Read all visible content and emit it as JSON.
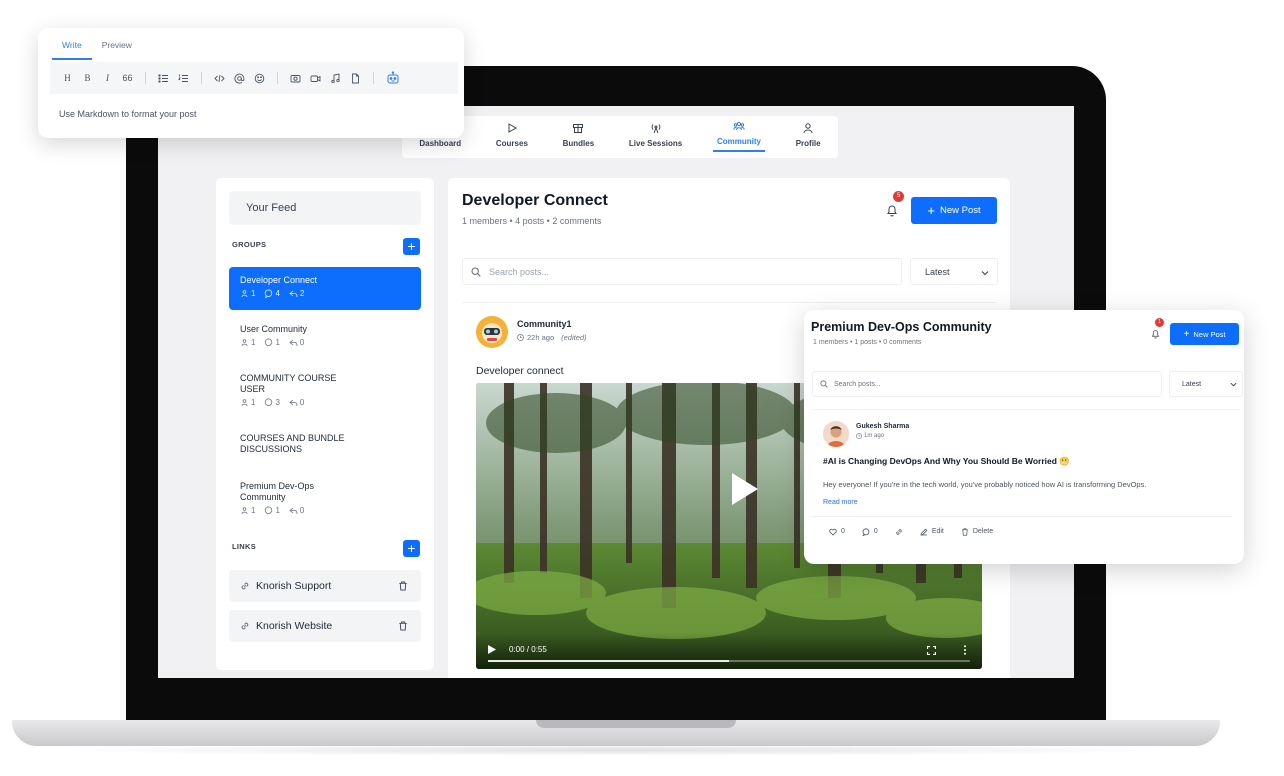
{
  "nav": {
    "items": [
      {
        "label": "Dashboard",
        "icon": "gauge-icon"
      },
      {
        "label": "Courses",
        "icon": "play-icon"
      },
      {
        "label": "Bundles",
        "icon": "box-icon"
      },
      {
        "label": "Live Sessions",
        "icon": "broadcast-icon"
      },
      {
        "label": "Community",
        "icon": "users-icon"
      },
      {
        "label": "Profile",
        "icon": "user-icon"
      }
    ],
    "active": "Community"
  },
  "sidebar": {
    "feed_label": "Your Feed",
    "groups_heading": "GROUPS",
    "add_symbol": "+",
    "groups": [
      {
        "name": "Developer Connect",
        "members": "1",
        "posts": "4",
        "comments": "2"
      },
      {
        "name": "User Community",
        "members": "1",
        "posts": "1",
        "comments": "0"
      },
      {
        "name": "COMMUNITY COURSE\nUSER",
        "members": "1",
        "posts": "3",
        "comments": "0"
      },
      {
        "name": "COURSES AND BUNDLE\nDISCUSSIONS"
      },
      {
        "name": "Premium Dev-Ops\nCommunity",
        "members": "1",
        "posts": "1",
        "comments": "0"
      }
    ],
    "links_heading": "LINKS",
    "links": [
      {
        "label": "Knorish Support"
      },
      {
        "label": "Knorish Website"
      }
    ]
  },
  "main": {
    "title": "Developer Connect",
    "meta": "1 members • 4 posts • 2 comments",
    "notification_count": "5",
    "new_post_label": "New Post",
    "search_placeholder": "Search posts...",
    "sort_value": "Latest",
    "post": {
      "author": "Community1",
      "time": "22h ago",
      "edited": "(edited)",
      "text": "Developer connect",
      "video": {
        "time": "0:00 / 0:55",
        "buffered_fraction": 0.5
      }
    }
  },
  "editor": {
    "tabs": [
      "Write",
      "Preview"
    ],
    "active_tab": "Write",
    "toolbar": [
      "H",
      "B",
      "I",
      "66"
    ],
    "placeholder": "Use Markdown to format your post"
  },
  "float_card": {
    "title": "Premium Dev-Ops Community",
    "meta": "1 members • 1 posts • 0 comments",
    "notification_count": "1",
    "new_post_label": "New Post",
    "search_placeholder": "Search posts...",
    "sort_value": "Latest",
    "post": {
      "author": "Gukesh Sharma",
      "time": "1m ago",
      "headline": "#AI is Changing DevOps And Why You Should Be Worried 😬",
      "body": "Hey everyone! If you're in the tech world, you've probably noticed how AI is transforming DevOps.",
      "read_more": "Read more",
      "likes": "0",
      "comments": "0",
      "edit_label": "Edit",
      "delete_label": "Delete"
    }
  },
  "colors": {
    "accent": "#0d6efd",
    "badge": "#e53935",
    "laptop": "#0b0b0c"
  }
}
